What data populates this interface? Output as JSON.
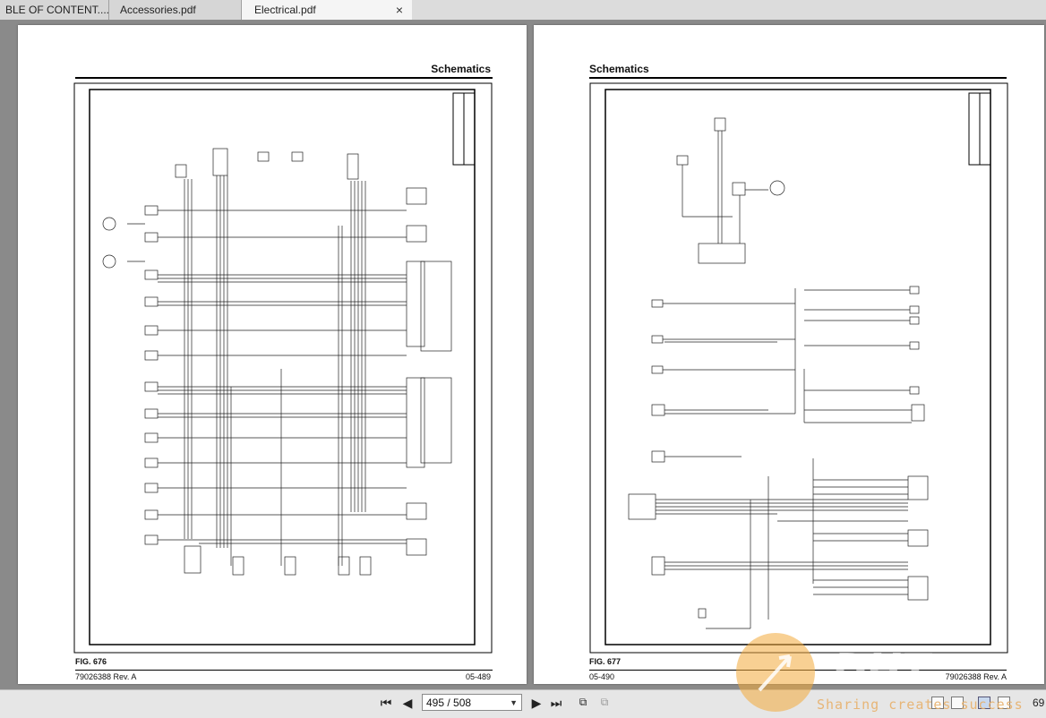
{
  "tabs": [
    {
      "label": "BLE OF CONTENT...."
    },
    {
      "label": "Accessories.pdf"
    },
    {
      "label": "Electrical.pdf",
      "close": "×"
    }
  ],
  "pages": [
    {
      "section_title": "Schematics",
      "figure_label": "FIG. 676",
      "doc_number": "79026388 Rev. A",
      "page_number": "05-489"
    },
    {
      "section_title": "Schematics",
      "figure_label": "FIG. 677",
      "page_number": "05-490",
      "doc_number": "79026388 Rev. A"
    }
  ],
  "navigation": {
    "current_page": "495 / 508",
    "zoom_level": "69"
  },
  "watermark": {
    "slogan": "Sharing creates success"
  },
  "icons": {
    "first": "first-page-icon",
    "prev": "previous-page-icon",
    "next": "next-page-icon",
    "last": "last-page-icon",
    "back": "go-back-icon",
    "forward": "go-forward-icon"
  }
}
